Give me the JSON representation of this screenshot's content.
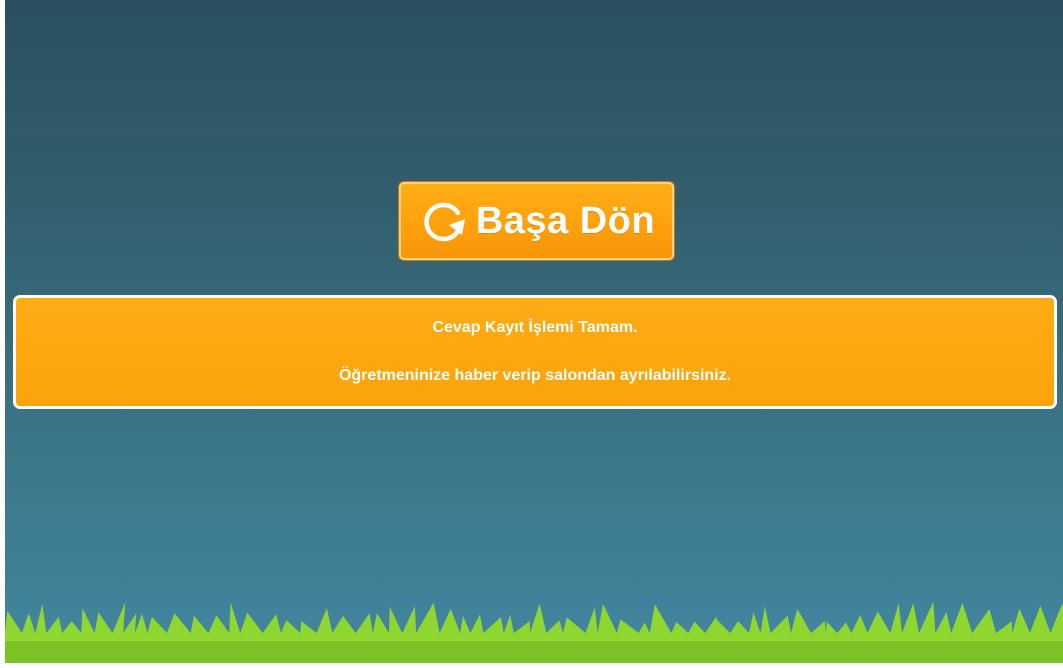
{
  "restart_button": {
    "label": "Başa Dön",
    "icon": "refresh-icon"
  },
  "message": {
    "line1": "Cevap Kayıt İşlemi Tamam.",
    "line2": "Öğretmeninize haber verip salondan ayrılabilirsiniz."
  },
  "colors": {
    "background_top": "#2a505f",
    "background_bottom": "#4287a0",
    "accent_orange": "#ffa70e",
    "grass": "#8fd631"
  }
}
